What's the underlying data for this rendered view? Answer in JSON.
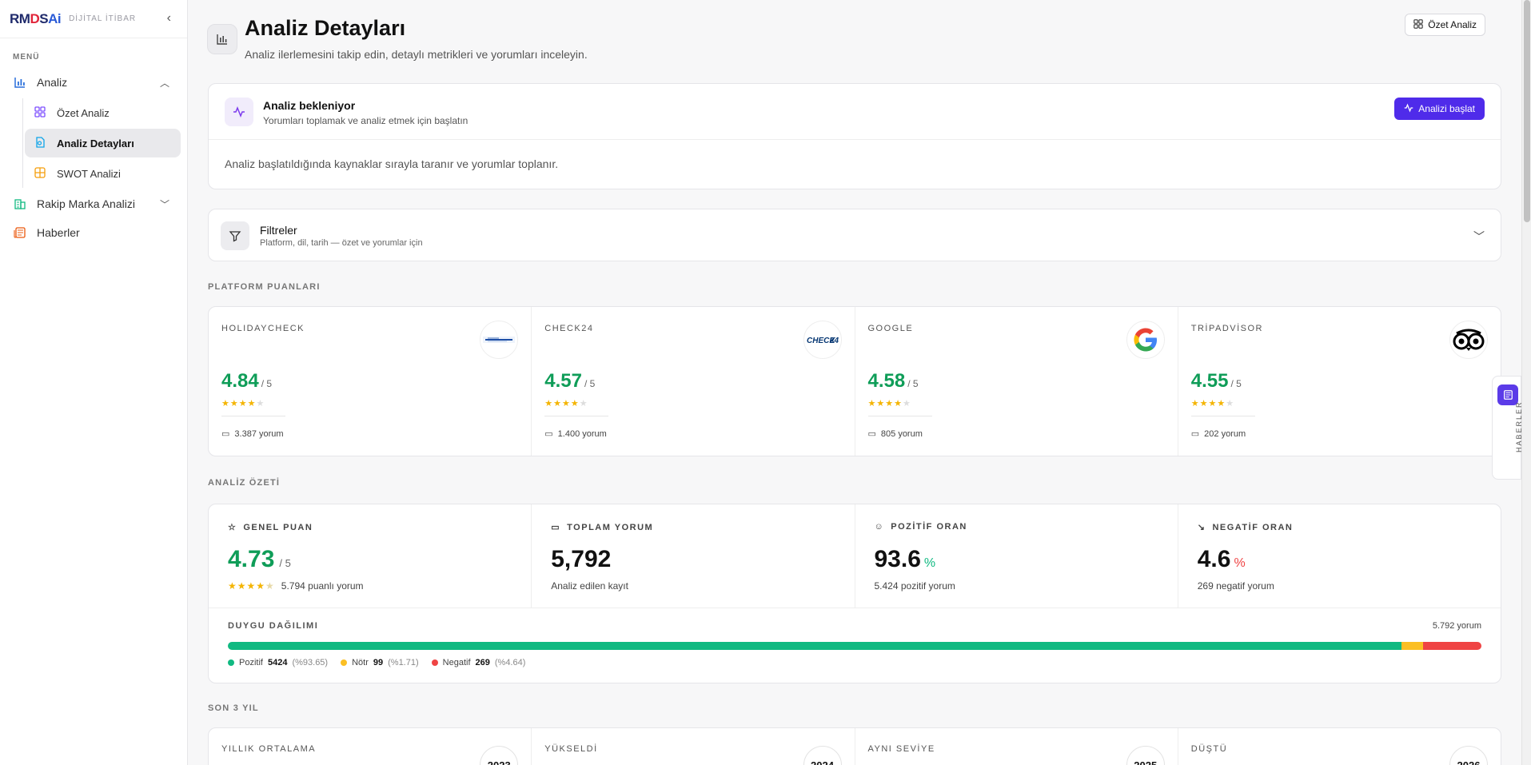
{
  "brand": {
    "logo_part1": "RM",
    "logo_part2": "D",
    "logo_part3": "S",
    "logo_part4": "Ai",
    "subtitle": "DİJİTAL İTİBAR"
  },
  "sidebar": {
    "menu_title": "MENÜ",
    "analiz": "Analiz",
    "sub_items": [
      "Özet Analiz",
      "Analiz Detayları",
      "SWOT Analizi"
    ],
    "rakip": "Rakip Marka Analizi",
    "haberler": "Haberler"
  },
  "header": {
    "title": "Analiz Detayları",
    "subtitle": "Analiz ilerlemesini takip edin, detaylı metrikleri ve yorumları inceleyin.",
    "ozet_button": "Özet Analiz"
  },
  "pending": {
    "title": "Analiz bekleniyor",
    "subtitle": "Yorumları toplamak ve analiz etmek için başlatın",
    "button": "Analizi başlat",
    "body": "Analiz başlatıldığında kaynaklar sırayla taranır ve yorumlar toplanır."
  },
  "filters": {
    "title": "Filtreler",
    "subtitle": "Platform, dil, tarih — özet ve yorumlar için"
  },
  "sections": {
    "platform": "PLATFORM PUANLARI",
    "summary": "ANALİZ ÖZETİ",
    "years": "SON 3 YIL"
  },
  "platforms": [
    {
      "name": "HOLIDAYCHECK",
      "score": "4.84",
      "of": "/ 5",
      "count": "3.387 yorum",
      "stars": 4
    },
    {
      "name": "CHECK24",
      "score": "4.57",
      "of": "/ 5",
      "count": "1.400 yorum",
      "stars": 4
    },
    {
      "name": "GOOGLE",
      "score": "4.58",
      "of": "/ 5",
      "count": "805 yorum",
      "stars": 4
    },
    {
      "name": "TRİPADVİSOR",
      "score": "4.55",
      "of": "/ 5",
      "count": "202 yorum",
      "stars": 4
    }
  ],
  "summary": {
    "genel": {
      "label": "GENEL PUAN",
      "value": "4.73",
      "unit": "/ 5",
      "sub": "5.794 puanlı yorum"
    },
    "toplam": {
      "label": "TOPLAM YORUM",
      "value": "5,792",
      "sub": "Analiz edilen kayıt"
    },
    "pozitif": {
      "label": "POZİTİF ORAN",
      "value": "93.6",
      "unit": "%",
      "sub": "5.424 pozitif yorum"
    },
    "negatif": {
      "label": "NEGATİF ORAN",
      "value": "4.6",
      "unit": "%",
      "sub": "269 negatif yorum"
    }
  },
  "distribution": {
    "label": "DUYGU DAĞILIMI",
    "total": "5.792 yorum",
    "positive": {
      "name": "Pozitif",
      "count": "5424",
      "pct": "(%93.65)",
      "fraction": 0.9365
    },
    "neutral": {
      "name": "Nötr",
      "count": "99",
      "pct": "(%1.71)",
      "fraction": 0.0171
    },
    "negative": {
      "name": "Negatif",
      "count": "269",
      "pct": "(%4.64)",
      "fraction": 0.0464
    }
  },
  "years": [
    {
      "label": "YILLIK ORTALAMA",
      "year": "2023"
    },
    {
      "label": "YÜKSELDİ",
      "year": "2024"
    },
    {
      "label": "AYNI SEVİYE",
      "year": "2025"
    },
    {
      "label": "DÜŞTÜ",
      "year": "2026"
    }
  ],
  "news_tab": "HABERLER",
  "colors": {
    "accent": "#4f2bea",
    "positive": "#10b981",
    "neutral": "#fbbf24",
    "negative": "#ef4444",
    "score_green": "#0f9d58"
  }
}
